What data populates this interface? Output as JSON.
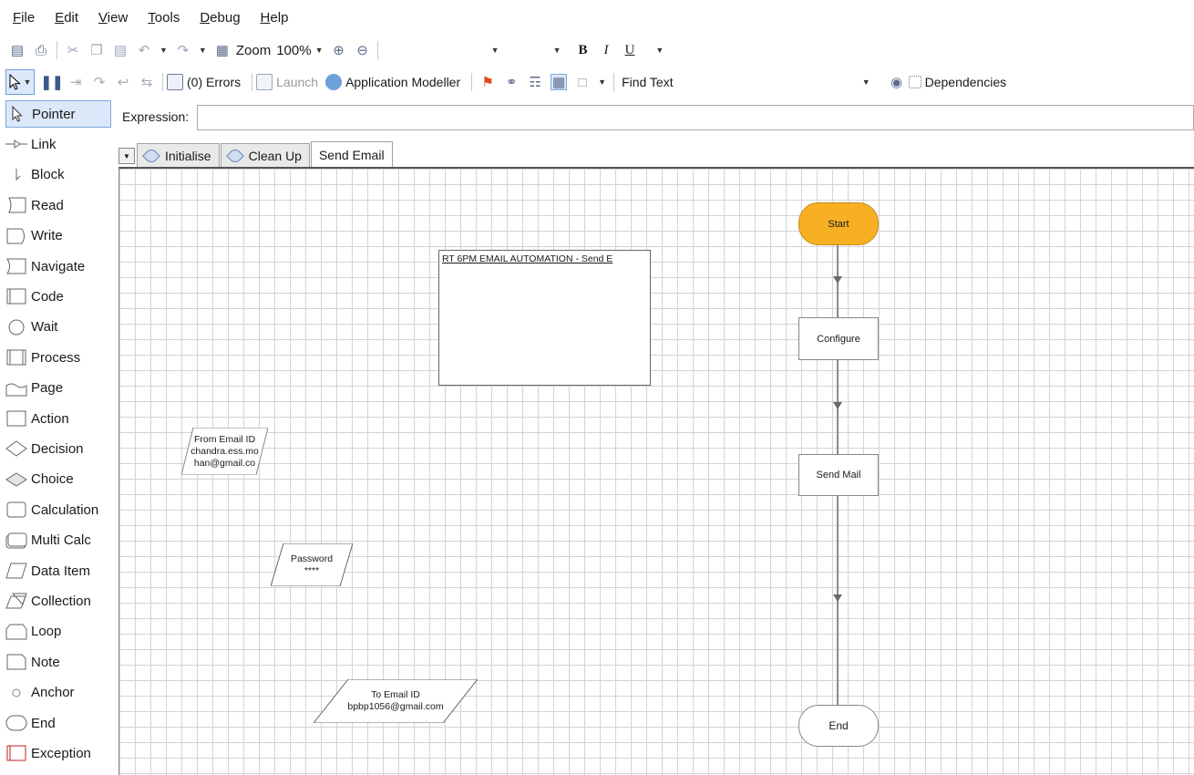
{
  "menu": [
    "File",
    "Edit",
    "View",
    "Tools",
    "Debug",
    "Help"
  ],
  "toolbar1": {
    "zoom_label": "Zoom",
    "zoom_value": "100%",
    "bold": "B",
    "italic": "I",
    "underline": "U"
  },
  "toolbar2": {
    "errors": "(0) Errors",
    "launch": "Launch",
    "app_modeller": "Application Modeller",
    "find_text": "Find Text",
    "dependencies": "Dependencies"
  },
  "palette": [
    {
      "label": "Pointer",
      "shape": "pointer"
    },
    {
      "label": "Link",
      "shape": "link"
    },
    {
      "label": "Block",
      "shape": "block"
    },
    {
      "label": "Read",
      "shape": "read"
    },
    {
      "label": "Write",
      "shape": "write"
    },
    {
      "label": "Navigate",
      "shape": "navigate"
    },
    {
      "label": "Code",
      "shape": "code"
    },
    {
      "label": "Wait",
      "shape": "wait"
    },
    {
      "label": "Process",
      "shape": "process"
    },
    {
      "label": "Page",
      "shape": "page"
    },
    {
      "label": "Action",
      "shape": "action"
    },
    {
      "label": "Decision",
      "shape": "decision"
    },
    {
      "label": "Choice",
      "shape": "choice"
    },
    {
      "label": "Calculation",
      "shape": "calculation"
    },
    {
      "label": "Multi Calc",
      "shape": "multicalc"
    },
    {
      "label": "Data Item",
      "shape": "dataitem"
    },
    {
      "label": "Collection",
      "shape": "collection"
    },
    {
      "label": "Loop",
      "shape": "loop"
    },
    {
      "label": "Note",
      "shape": "note"
    },
    {
      "label": "Anchor",
      "shape": "anchor"
    },
    {
      "label": "End",
      "shape": "end"
    },
    {
      "label": "Exception",
      "shape": "exception"
    }
  ],
  "expression": {
    "label": "Expression:",
    "value": ""
  },
  "tabs": [
    "Initialise",
    "Clean Up",
    "Send Email"
  ],
  "active_tab": "Send Email",
  "flow": {
    "start": "Start",
    "configure": "Configure",
    "send_mail": "Send Mail",
    "end": "End"
  },
  "block": {
    "title": "RT 6PM EMAIL AUTOMATION  -  Send E"
  },
  "data_items": {
    "from": {
      "line1": "From Email ID",
      "line2": "chandra.ess.mo",
      "line3": "han@gmail.co"
    },
    "password": {
      "line1": "Password",
      "line2": "****"
    },
    "to": {
      "line1": "To Email ID",
      "line2": "bpbp1056@gmail.com"
    }
  },
  "colors": {
    "start_fill": "#f7b024",
    "selection": "#dbe8fa",
    "grid": "#d4d4d4"
  }
}
